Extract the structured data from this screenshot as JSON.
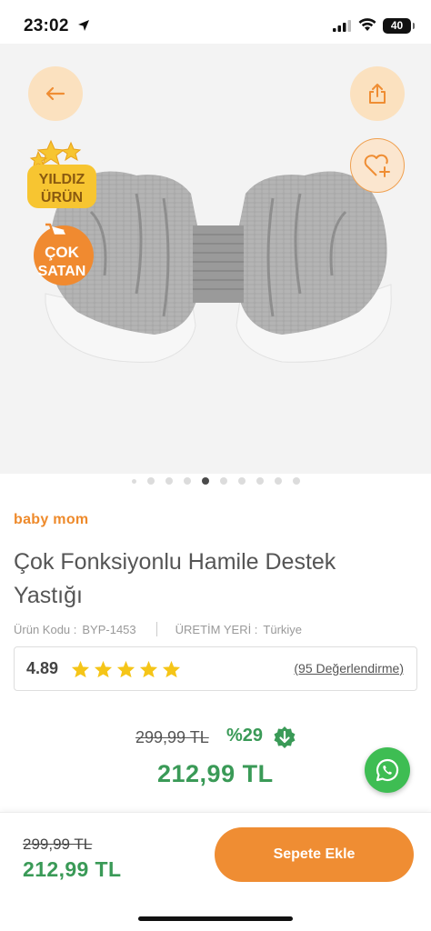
{
  "status": {
    "time": "23:02",
    "battery": "40"
  },
  "badges": {
    "star_line1": "YILDIZ",
    "star_line2": "ÜRÜN",
    "cart_line1": "ÇOK",
    "cart_line2": "SATAN"
  },
  "pagination": {
    "total": 10,
    "active_index": 4
  },
  "product": {
    "brand": "baby mom",
    "title": "Çok Fonksiyonlu Hamile Destek Yastığı",
    "code_label": "Ürün Kodu :",
    "code_value": "BYP-1453",
    "origin_label": "ÜRETİM YERİ :",
    "origin_value": "Türkiye",
    "rating": "4.89",
    "stars": 5,
    "reviews": "(95 Değerlendirme)",
    "old_price": "299,99 TL",
    "discount": "%29",
    "new_price": "212,99 TL"
  },
  "bottom_bar": {
    "old_price": "299,99 TL",
    "new_price": "212,99 TL",
    "add_to_cart": "Sepete Ekle"
  },
  "colors": {
    "accent": "#ef8d33",
    "price_green": "#3a9a57",
    "star": "#f5c518",
    "whatsapp": "#3ebd53"
  }
}
